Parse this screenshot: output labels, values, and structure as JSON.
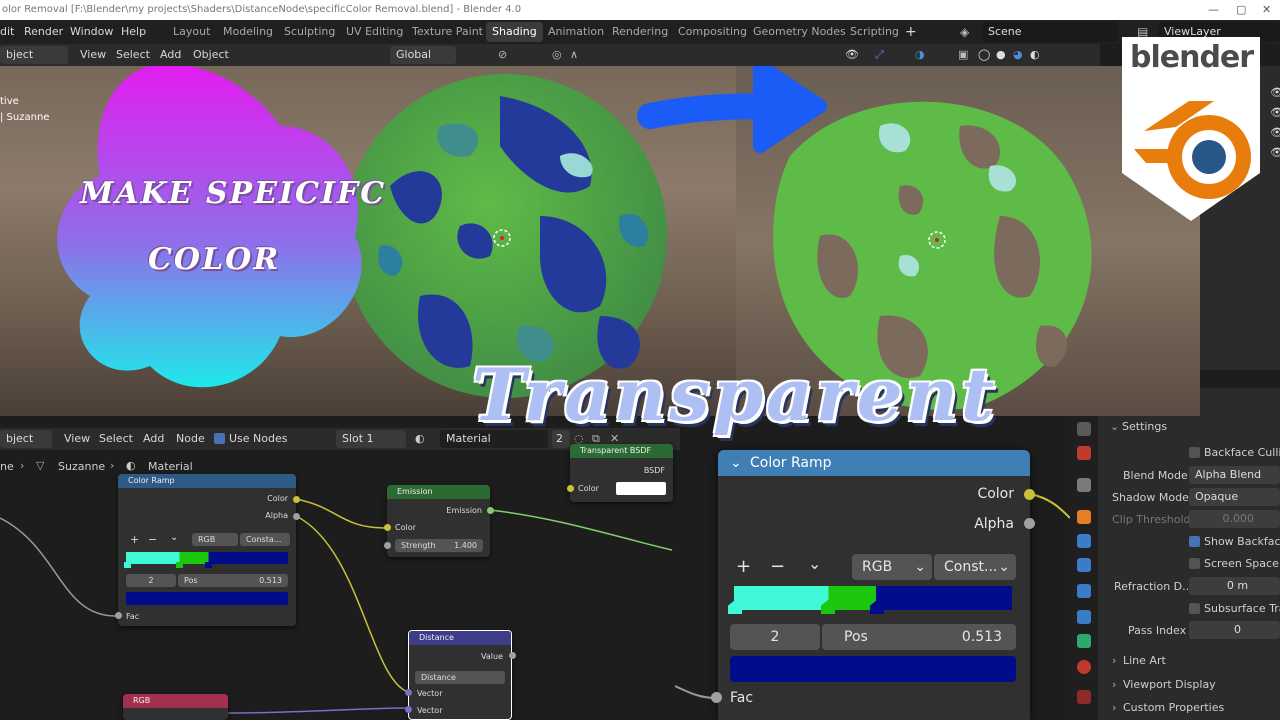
{
  "titlebar": {
    "title": "olor Removal [F:\\Blender\\my projects\\Shaders\\DistanceNode\\specificColor Removal.blend] - Blender 4.0"
  },
  "menubar": {
    "menus": [
      "dit",
      "Render",
      "Window",
      "Help"
    ],
    "workspaces": [
      "Layout",
      "Modeling",
      "Sculpting",
      "UV Editing",
      "Texture Paint",
      "Shading",
      "Animation",
      "Rendering",
      "Compositing",
      "Geometry Nodes",
      "Scripting"
    ],
    "active_workspace": "Shading",
    "add_tab": "+",
    "scene": "Scene",
    "view_layer": "ViewLayer"
  },
  "viewport": {
    "mode": "bject Mode",
    "menus": [
      "View",
      "Select",
      "Add",
      "Object"
    ],
    "orientation": "Global",
    "overlay_line1": "tive",
    "overlay_line2": "| Suzanne"
  },
  "node_editor": {
    "object_dd": "bject",
    "menus": [
      "View",
      "Select",
      "Add",
      "Node"
    ],
    "use_nodes": "Use Nodes",
    "slot": "Slot 1",
    "material": "Material",
    "users": "2",
    "breadcrumb_object": "Suzanne",
    "breadcrumb_material": "Material",
    "breadcrumb_prefix": "ne"
  },
  "nodes": {
    "color_ramp": {
      "title": "Color Ramp",
      "out_color": "Color",
      "out_alpha": "Alpha",
      "plus": "+",
      "minus": "−",
      "chevron": "⌄",
      "mode": "RGB",
      "interp": "Consta...",
      "index": "2",
      "pos_label": "Pos",
      "pos_value": "0.513",
      "in_fac": "Fac"
    },
    "emission": {
      "title": "Emission",
      "out": "Emission",
      "in_color": "Color",
      "strength_label": "Strength",
      "strength_value": "1.400"
    },
    "transparent": {
      "title": "Transparent BSDF",
      "out": "BSDF",
      "in_color": "Color"
    },
    "distance": {
      "title": "Distance",
      "out": "Value",
      "op": "Distance",
      "in1": "Vector",
      "in2": "Vector"
    },
    "rgb": {
      "title": "RGB"
    }
  },
  "big_ramp": {
    "title": "Color Ramp",
    "out_color": "Color",
    "out_alpha": "Alpha",
    "plus": "+",
    "minus": "−",
    "chevron": "⌄",
    "mode": "RGB",
    "interp": "Const...",
    "index": "2",
    "pos_label": "Pos",
    "pos_value": "0.513",
    "in_fac": "Fac"
  },
  "properties": {
    "section": "Settings",
    "backface_culling": "Backface Culling",
    "blend_mode_label": "Blend Mode",
    "blend_mode": "Alpha Blend",
    "shadow_mode_label": "Shadow Mode",
    "shadow_mode": "Opaque",
    "clip_label": "Clip Threshold",
    "clip_value": "0.000",
    "show_backface": "Show Backface",
    "screen_space": "Screen Space Ra",
    "refraction_label": "Refraction D...",
    "refraction_value": "0 m",
    "subsurface": "Subsurface Tran",
    "pass_index_label": "Pass Index",
    "pass_index": "0",
    "line_art": "Line Art",
    "viewport_display": "Viewport Display",
    "custom_properties": "Custom Properties"
  },
  "thumbnail": {
    "left_line1": "MAKE SPEICIFC",
    "left_line2": "COLOR",
    "big_title": "Transparent",
    "logo": "blender"
  },
  "colors": {
    "ramp_cyan": "#3ff8d6",
    "ramp_green": "#1bc70f",
    "ramp_blue": "#000c8a",
    "active_blue": "#4772b3",
    "node_header_blue": "#2e5b86",
    "emission_header": "#2b6a33",
    "distance_header": "#3d3d8a",
    "rgb_header": "#a4304f",
    "blender_orange": "#e87d0d",
    "blender_blue": "#265787"
  }
}
